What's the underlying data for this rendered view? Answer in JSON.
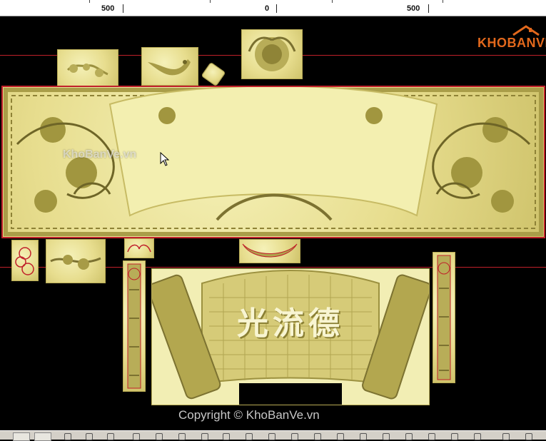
{
  "ruler": {
    "labels": [
      "500",
      "0",
      "500"
    ]
  },
  "logo": {
    "text": "KHOBANVE"
  },
  "watermark": {
    "text": "KhoBanVe.vn"
  },
  "canvas": {
    "calligraphy": "光流德"
  },
  "footer": {
    "copyright": "Copyright © KhoBanVe.vn"
  },
  "colors": {
    "relief": "#e9e19a",
    "relief_shadow": "#9c9140",
    "guide_line": "#c0202a",
    "outline": "#c0202a",
    "background": "#000000"
  }
}
